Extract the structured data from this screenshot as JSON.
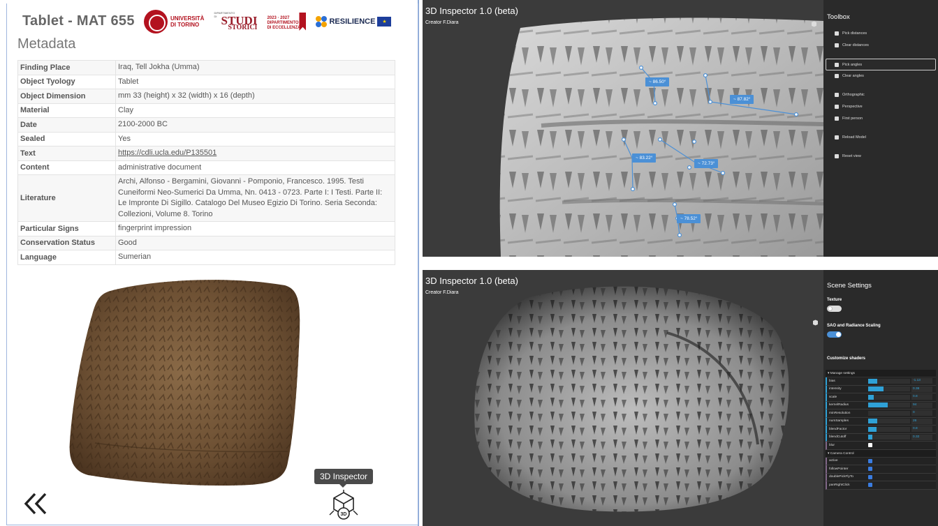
{
  "left": {
    "title": "Tablet - MAT 655",
    "subtitle": "Metadata",
    "logos": {
      "unito_line1": "UNIVERSITÀ",
      "unito_line2": "DI TORINO",
      "studi_big": "STUDI",
      "studi_small": "DIPARTIMENTO DI",
      "studi_big2": "STORICI",
      "dip_line1": "2023 · 2027",
      "dip_line2": "DIPARTIMENTO",
      "dip_line3": "DI ECCELLENZA",
      "resilience": "RESILIENCE"
    },
    "metadata": [
      {
        "key": "Finding Place",
        "value": "Iraq, Tell Jokha (Umma)"
      },
      {
        "key": "Object Tyology",
        "value": "Tablet"
      },
      {
        "key": "Object Dimension",
        "value": "mm 33 (height) x 32 (width) x 16 (depth)"
      },
      {
        "key": "Material",
        "value": "Clay"
      },
      {
        "key": "Date",
        "value": "2100-2000 BC"
      },
      {
        "key": "Sealed",
        "value": "Yes"
      },
      {
        "key": "Text",
        "value": "https://cdli.ucla.edu/P135501"
      },
      {
        "key": "Content",
        "value": "administrative document"
      },
      {
        "key": "Literature",
        "value": "Archi, Alfonso - Bergamini, Giovanni - Pomponio, Francesco. 1995. Testi Cuneiformi Neo-Sumerici Da Umma, Nn. 0413 - 0723. Parte I: I Testi. Parte II: Le Impronte Di Sigillo. Catalogo Del Museo Egizio Di Torino. Seria Seconda: Collezioni, Volume 8. Torino"
      },
      {
        "key": "Particular Signs",
        "value": "fingerprint impression"
      },
      {
        "key": "Conservation Status",
        "value": "Good"
      },
      {
        "key": "Language",
        "value": "Sumerian"
      }
    ],
    "tooltip": "3D Inspector",
    "inspector_icon_text": "3D"
  },
  "viewer_top": {
    "title": "3D Inspector 1.0   (beta)",
    "creator": "Creator F.Diara",
    "toolbox_title": "Toolbox",
    "tools": [
      {
        "label": "Pick distances",
        "icon": "ruler-icon"
      },
      {
        "label": "Clear distances",
        "icon": "trash-icon"
      },
      {
        "label": "Pick angles",
        "icon": "angle-icon",
        "selected": true
      },
      {
        "label": "Clear angles",
        "icon": "trash-icon"
      },
      {
        "label": "Orthographic",
        "icon": "cube-icon"
      },
      {
        "label": "Perspective",
        "icon": "cube-icon"
      },
      {
        "label": "First person",
        "icon": "cube-icon"
      },
      {
        "label": "Reload Model",
        "icon": "reload-icon"
      },
      {
        "label": "Reset view",
        "icon": "eye-icon"
      }
    ],
    "angles": [
      "~ 86.50°",
      "~ 87.82°",
      "~ 83.22°",
      "~ 72.73°",
      "~ 78.52°"
    ]
  },
  "viewer_bottom": {
    "title": "3D Inspector 1.0   (beta)",
    "creator": "Creator F.Diara",
    "settings_title": "Scene Settings",
    "texture_label": "Texture",
    "texture_on": false,
    "sao_label": "SAO and Radiance Scaling",
    "sao_on": true,
    "shaders_label": "Customize shaders",
    "manage_label": "Manage settings",
    "params": [
      {
        "name": "bias",
        "value": "-1.13",
        "fill": 0.22
      },
      {
        "name": "intensity",
        "value": "0.36",
        "fill": 0.36
      },
      {
        "name": "scale",
        "value": "0.8",
        "fill": 0.13
      },
      {
        "name": "kernelRadius",
        "value": "94",
        "fill": 0.47
      },
      {
        "name": "minResolution",
        "value": "0",
        "fill": 0
      },
      {
        "name": "numSamples",
        "value": "26",
        "fill": 0.22
      },
      {
        "name": "blendFactor",
        "value": "0.8",
        "fill": 0.2
      },
      {
        "name": "blendCutoff",
        "value": "0.32",
        "fill": 0.1
      }
    ],
    "blur_label": "blur",
    "camera_label": "Camera Control",
    "camera": [
      {
        "name": "active",
        "checked": true
      },
      {
        "name": "followPointer",
        "checked": true
      },
      {
        "name": "doublePickFlyTo",
        "checked": true
      },
      {
        "name": "panRightClick",
        "checked": true
      }
    ]
  },
  "colors": {
    "accent_blue": "#4b90d6",
    "unito_red": "#b3121f",
    "viewer_bg": "#3b3b3b",
    "panel_bg": "#2a2a2a"
  }
}
